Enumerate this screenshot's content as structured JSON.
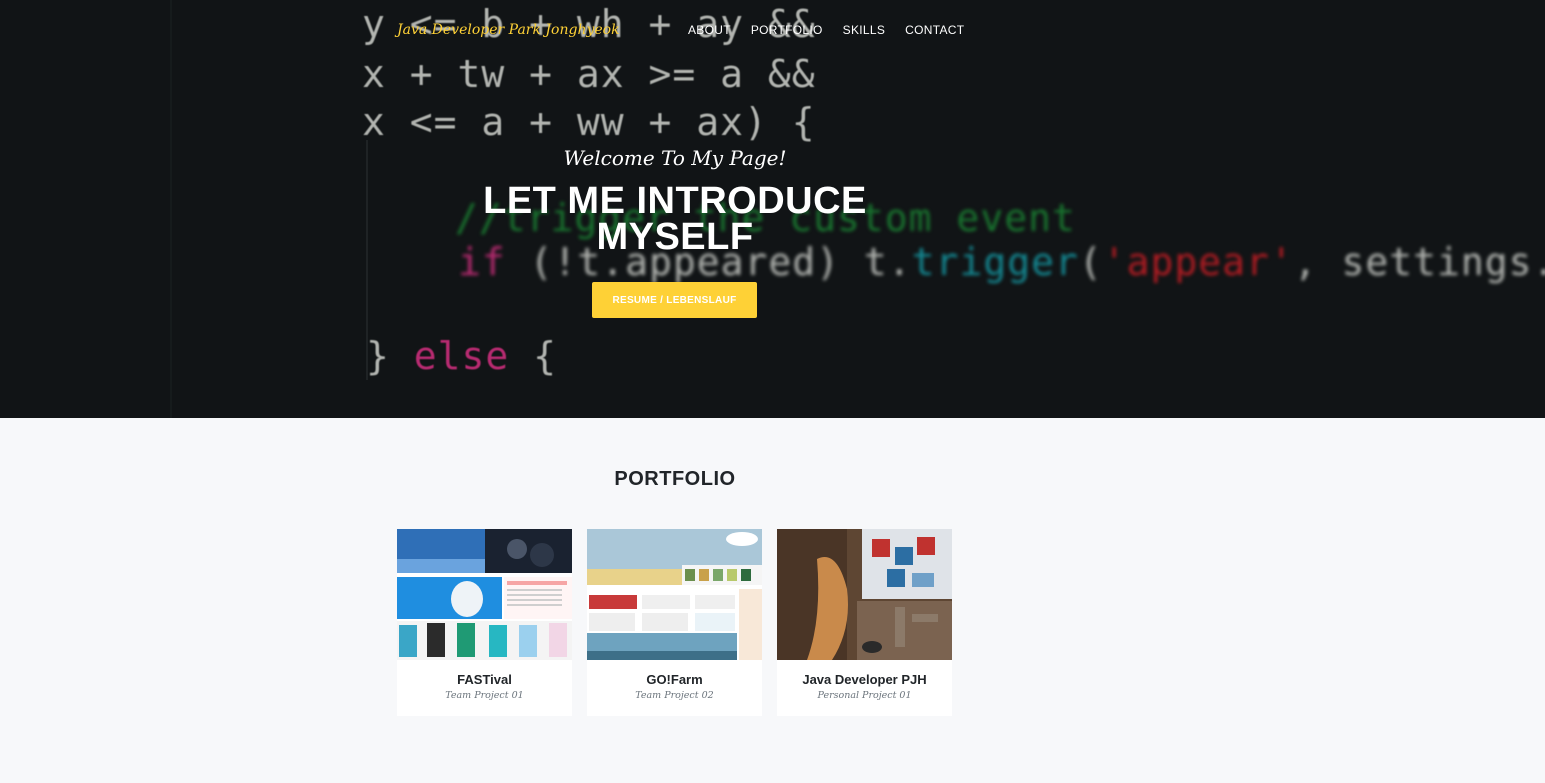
{
  "nav": {
    "brand": "Java Developer Park Jonghyeok",
    "items": [
      "ABOUT",
      "PORTFOLIO",
      "SKILLS",
      "CONTACT"
    ]
  },
  "hero": {
    "welcome": "Welcome To My Page!",
    "headline": "LET ME INTRODUCE MYSELF",
    "button_label": "RESUME / LEBENSLAUF"
  },
  "portfolio": {
    "title": "PORTFOLIO",
    "items": [
      {
        "title": "FASTival",
        "subtitle": "Team Project 01"
      },
      {
        "title": "GO!Farm",
        "subtitle": "Team Project 02"
      },
      {
        "title": "Java Developer PJH",
        "subtitle": "Personal Project 01"
      }
    ]
  },
  "colors": {
    "accent": "#fed136",
    "hero_bg": "#15191b",
    "section_bg": "#f7f8fa"
  }
}
